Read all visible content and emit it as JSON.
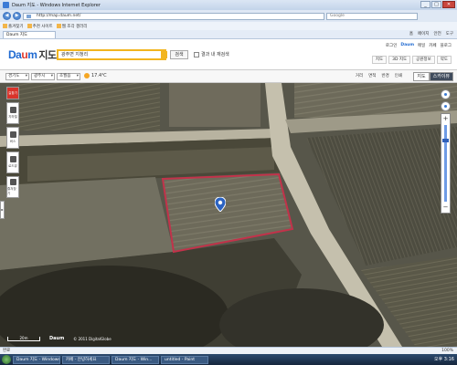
{
  "window": {
    "title": "Daum 지도 - Windows Internet Explorer"
  },
  "address": {
    "url": "http://map.daum.net/",
    "search_placeholder": "Google"
  },
  "favorites": {
    "items": [
      "즐겨찾기",
      "추천 사이트",
      "웹 조각 갤러리",
      "Daum 지도"
    ]
  },
  "tab": {
    "label": "Daum 지도"
  },
  "commands": [
    "홈",
    "페이지",
    "안전",
    "도구"
  ],
  "header": {
    "logo_daum": "Da",
    "logo_o": "u",
    "logo_m": "m",
    "logo_jido": "지도",
    "search_value": "광주면 지청리",
    "search_button": "검색",
    "checkbox_label": "결과 내 재검색",
    "toplinks": [
      "로그인",
      "Daum",
      "메일",
      "카페",
      "블로그"
    ],
    "service_buttons": [
      "지도",
      "3D 지도",
      "공원정보",
      "약도"
    ]
  },
  "toolbar": {
    "region1": "경기도",
    "region2": "광주시",
    "region3": "초월읍",
    "weather": "17.4℃",
    "tools": [
      "거리",
      "면적",
      "반경",
      "인쇄"
    ],
    "maptype": [
      "지도",
      "스카이뷰"
    ]
  },
  "lefttools": [
    "길찾기",
    "지하철",
    "버스",
    "로드뷰",
    "즐겨찾기"
  ],
  "zoom": {
    "level_fraction": 0.18
  },
  "map": {
    "scale_label": "20m",
    "copyright": "© 2011 DigitalGlobe",
    "logo": "Daum"
  },
  "statusbar": {
    "text": "완료",
    "zoom": "100%"
  },
  "taskbar": {
    "tasks": [
      "Daum 지도 - Windows",
      "카페 - 안녕하세요",
      "Daum 지도 - Win...",
      "untitled - Paint"
    ],
    "clock": "오후 3:16"
  },
  "colors": {
    "accent": "#1f6ad1",
    "search_border": "#f2b51f",
    "parcel": "#c2324a",
    "marker": "#2b63c2"
  }
}
